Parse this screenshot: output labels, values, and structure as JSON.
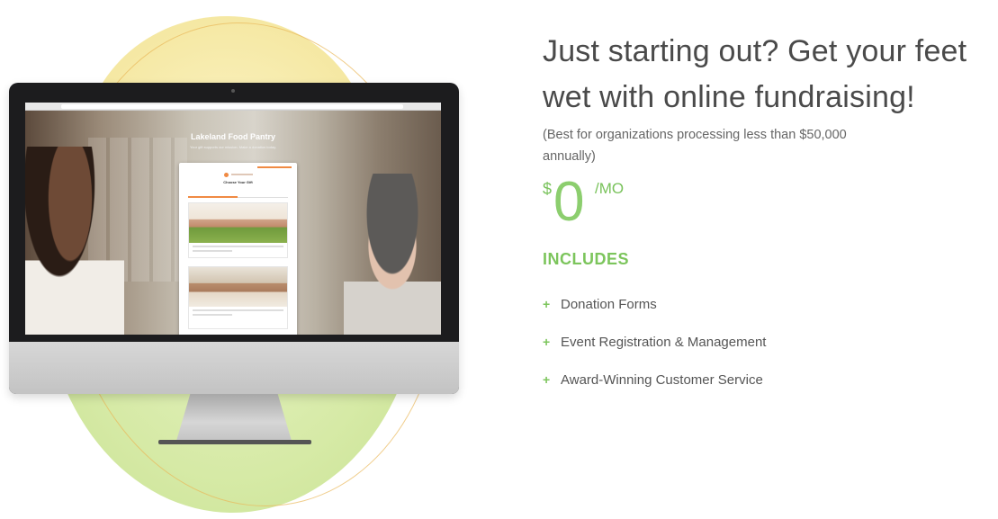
{
  "illustration": {
    "site_title": "Lakeland Food Pantry",
    "site_subtitle": "Your gift supports our mission. Make a donation today.",
    "form_heading": "Choose Your Gift"
  },
  "headline": "Just starting out? Get your feet wet with online fundraising!",
  "subnote": "(Best for organizations processing less than $50,000 annually)",
  "price": {
    "currency": "$",
    "amount": "0",
    "period": "/MO"
  },
  "includes_title": "INCLUDES",
  "features": [
    "Donation Forms",
    "Event Registration & Management",
    "Award-Winning Customer Service"
  ],
  "colors": {
    "accent_green": "#7cc55c",
    "yellow_circle": "#f5e8a3",
    "green_circle": "#d6eaa6",
    "ring": "#e9b85a",
    "form_accent": "#f08a43"
  }
}
